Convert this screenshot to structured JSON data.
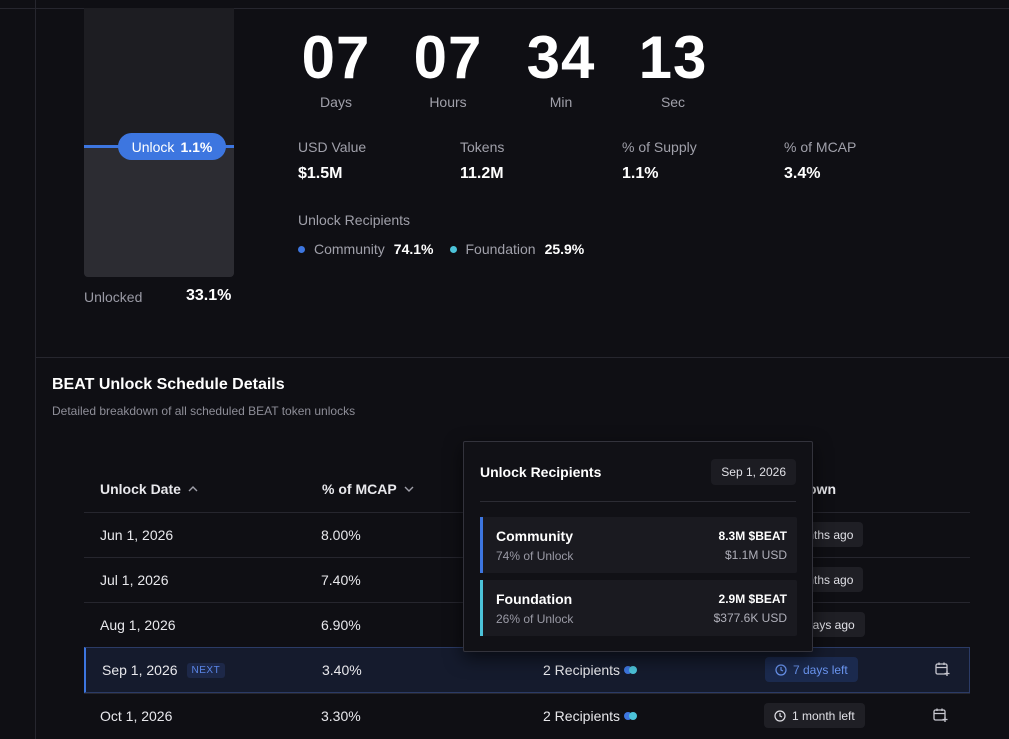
{
  "unlock_bar": {
    "pill_label": "Unlock",
    "pill_value": "1.1%",
    "unlocked_label": "Unlocked",
    "unlocked_value": "33.1%",
    "accent": "#3d76e0"
  },
  "countdown": [
    {
      "value": "07",
      "label": "Days"
    },
    {
      "value": "07",
      "label": "Hours"
    },
    {
      "value": "34",
      "label": "Min"
    },
    {
      "value": "13",
      "label": "Sec"
    }
  ],
  "stats": [
    {
      "label": "USD Value",
      "value": "$1.5M"
    },
    {
      "label": "Tokens",
      "value": "11.2M"
    },
    {
      "label": "% of Supply",
      "value": "1.1%"
    },
    {
      "label": "% of MCAP",
      "value": "3.4%"
    }
  ],
  "recipients": {
    "title": "Unlock Recipients",
    "items": [
      {
        "name": "Community",
        "pct": "74.1%",
        "color": "#3d76e0"
      },
      {
        "name": "Foundation",
        "pct": "25.9%",
        "color": "#4cc3d9"
      }
    ]
  },
  "schedule": {
    "title": "BEAT Unlock Schedule Details",
    "subtitle": "Detailed breakdown of all scheduled BEAT token unlocks",
    "columns": {
      "date": "Unlock Date",
      "mcap": "% of MCAP",
      "countdown": "own"
    },
    "rows": [
      {
        "date": "Jun 1, 2026",
        "mcap": "8.00%",
        "recipients": "",
        "countdown": "nonths ago"
      },
      {
        "date": "Jul 1, 2026",
        "mcap": "7.40%",
        "recipients": "",
        "countdown": "nonths ago"
      },
      {
        "date": "Aug 1, 2026",
        "mcap": "6.90%",
        "recipients": "",
        "countdown": "days ago"
      },
      {
        "date": "Sep 1, 2026",
        "mcap": "3.40%",
        "recipients": "2 Recipients",
        "countdown": "7 days left",
        "badge": "NEXT"
      },
      {
        "date": "Oct 1, 2026",
        "mcap": "3.30%",
        "recipients": "2 Recipients",
        "countdown": "1 month left"
      }
    ]
  },
  "popup": {
    "title": "Unlock Recipients",
    "date": "Sep 1, 2026",
    "items": [
      {
        "name": "Community",
        "share": "74% of Unlock",
        "amount": "8.3M $BEAT",
        "usd": "$1.1M USD",
        "color": "#3d76e0"
      },
      {
        "name": "Foundation",
        "share": "26% of Unlock",
        "amount": "2.9M $BEAT",
        "usd": "$377.6K USD",
        "color": "#4cc3d9"
      }
    ]
  }
}
